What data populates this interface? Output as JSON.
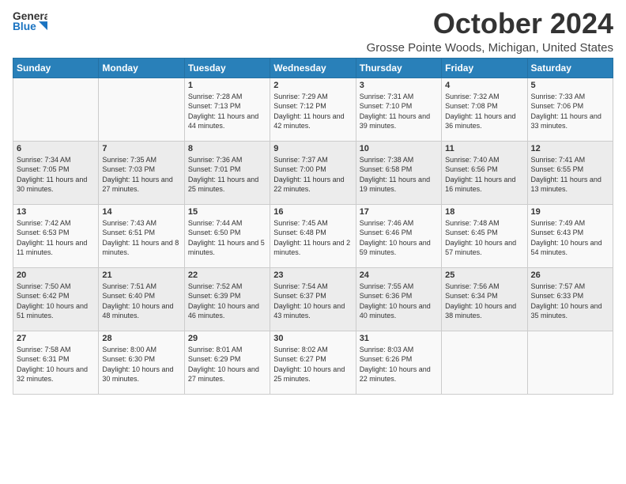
{
  "header": {
    "logo_line1": "General",
    "logo_line2": "Blue",
    "month": "October 2024",
    "location": "Grosse Pointe Woods, Michigan, United States"
  },
  "weekdays": [
    "Sunday",
    "Monday",
    "Tuesday",
    "Wednesday",
    "Thursday",
    "Friday",
    "Saturday"
  ],
  "weeks": [
    [
      {
        "day": "",
        "info": ""
      },
      {
        "day": "",
        "info": ""
      },
      {
        "day": "1",
        "info": "Sunrise: 7:28 AM\nSunset: 7:13 PM\nDaylight: 11 hours and 44 minutes."
      },
      {
        "day": "2",
        "info": "Sunrise: 7:29 AM\nSunset: 7:12 PM\nDaylight: 11 hours and 42 minutes."
      },
      {
        "day": "3",
        "info": "Sunrise: 7:31 AM\nSunset: 7:10 PM\nDaylight: 11 hours and 39 minutes."
      },
      {
        "day": "4",
        "info": "Sunrise: 7:32 AM\nSunset: 7:08 PM\nDaylight: 11 hours and 36 minutes."
      },
      {
        "day": "5",
        "info": "Sunrise: 7:33 AM\nSunset: 7:06 PM\nDaylight: 11 hours and 33 minutes."
      }
    ],
    [
      {
        "day": "6",
        "info": "Sunrise: 7:34 AM\nSunset: 7:05 PM\nDaylight: 11 hours and 30 minutes."
      },
      {
        "day": "7",
        "info": "Sunrise: 7:35 AM\nSunset: 7:03 PM\nDaylight: 11 hours and 27 minutes."
      },
      {
        "day": "8",
        "info": "Sunrise: 7:36 AM\nSunset: 7:01 PM\nDaylight: 11 hours and 25 minutes."
      },
      {
        "day": "9",
        "info": "Sunrise: 7:37 AM\nSunset: 7:00 PM\nDaylight: 11 hours and 22 minutes."
      },
      {
        "day": "10",
        "info": "Sunrise: 7:38 AM\nSunset: 6:58 PM\nDaylight: 11 hours and 19 minutes."
      },
      {
        "day": "11",
        "info": "Sunrise: 7:40 AM\nSunset: 6:56 PM\nDaylight: 11 hours and 16 minutes."
      },
      {
        "day": "12",
        "info": "Sunrise: 7:41 AM\nSunset: 6:55 PM\nDaylight: 11 hours and 13 minutes."
      }
    ],
    [
      {
        "day": "13",
        "info": "Sunrise: 7:42 AM\nSunset: 6:53 PM\nDaylight: 11 hours and 11 minutes."
      },
      {
        "day": "14",
        "info": "Sunrise: 7:43 AM\nSunset: 6:51 PM\nDaylight: 11 hours and 8 minutes."
      },
      {
        "day": "15",
        "info": "Sunrise: 7:44 AM\nSunset: 6:50 PM\nDaylight: 11 hours and 5 minutes."
      },
      {
        "day": "16",
        "info": "Sunrise: 7:45 AM\nSunset: 6:48 PM\nDaylight: 11 hours and 2 minutes."
      },
      {
        "day": "17",
        "info": "Sunrise: 7:46 AM\nSunset: 6:46 PM\nDaylight: 10 hours and 59 minutes."
      },
      {
        "day": "18",
        "info": "Sunrise: 7:48 AM\nSunset: 6:45 PM\nDaylight: 10 hours and 57 minutes."
      },
      {
        "day": "19",
        "info": "Sunrise: 7:49 AM\nSunset: 6:43 PM\nDaylight: 10 hours and 54 minutes."
      }
    ],
    [
      {
        "day": "20",
        "info": "Sunrise: 7:50 AM\nSunset: 6:42 PM\nDaylight: 10 hours and 51 minutes."
      },
      {
        "day": "21",
        "info": "Sunrise: 7:51 AM\nSunset: 6:40 PM\nDaylight: 10 hours and 48 minutes."
      },
      {
        "day": "22",
        "info": "Sunrise: 7:52 AM\nSunset: 6:39 PM\nDaylight: 10 hours and 46 minutes."
      },
      {
        "day": "23",
        "info": "Sunrise: 7:54 AM\nSunset: 6:37 PM\nDaylight: 10 hours and 43 minutes."
      },
      {
        "day": "24",
        "info": "Sunrise: 7:55 AM\nSunset: 6:36 PM\nDaylight: 10 hours and 40 minutes."
      },
      {
        "day": "25",
        "info": "Sunrise: 7:56 AM\nSunset: 6:34 PM\nDaylight: 10 hours and 38 minutes."
      },
      {
        "day": "26",
        "info": "Sunrise: 7:57 AM\nSunset: 6:33 PM\nDaylight: 10 hours and 35 minutes."
      }
    ],
    [
      {
        "day": "27",
        "info": "Sunrise: 7:58 AM\nSunset: 6:31 PM\nDaylight: 10 hours and 32 minutes."
      },
      {
        "day": "28",
        "info": "Sunrise: 8:00 AM\nSunset: 6:30 PM\nDaylight: 10 hours and 30 minutes."
      },
      {
        "day": "29",
        "info": "Sunrise: 8:01 AM\nSunset: 6:29 PM\nDaylight: 10 hours and 27 minutes."
      },
      {
        "day": "30",
        "info": "Sunrise: 8:02 AM\nSunset: 6:27 PM\nDaylight: 10 hours and 25 minutes."
      },
      {
        "day": "31",
        "info": "Sunrise: 8:03 AM\nSunset: 6:26 PM\nDaylight: 10 hours and 22 minutes."
      },
      {
        "day": "",
        "info": ""
      },
      {
        "day": "",
        "info": ""
      }
    ]
  ]
}
